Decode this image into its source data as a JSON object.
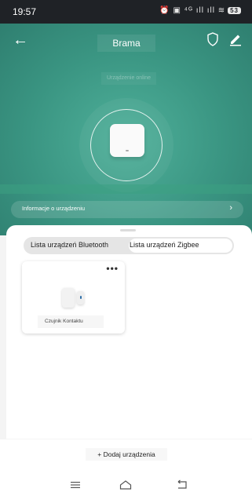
{
  "status_bar": {
    "time": "19:57",
    "icons": "⏰ ▣ ⁴ᴳ ıll ıll ≋",
    "battery": "53"
  },
  "header": {
    "title": "Brama",
    "status": "Urządzenie online",
    "icons": [
      "back-arrow-icon",
      "shield-icon",
      "edit-icon"
    ]
  },
  "info_bar": {
    "label": "Informacje o urządzeniu"
  },
  "tabs": [
    {
      "label": "Lista urządzeń Bluetooth",
      "selected": false
    },
    {
      "label": "Lista urządzeń Zigbee",
      "selected": true
    }
  ],
  "devices": [
    {
      "name": "Czujnik Kontaktu",
      "menu": "•••"
    }
  ],
  "footer": {
    "add_label": "+ Dodaj urządzenia"
  },
  "colors": {
    "accent": "#3a9582",
    "background": "#f4f4f4",
    "card": "#ffffff"
  }
}
